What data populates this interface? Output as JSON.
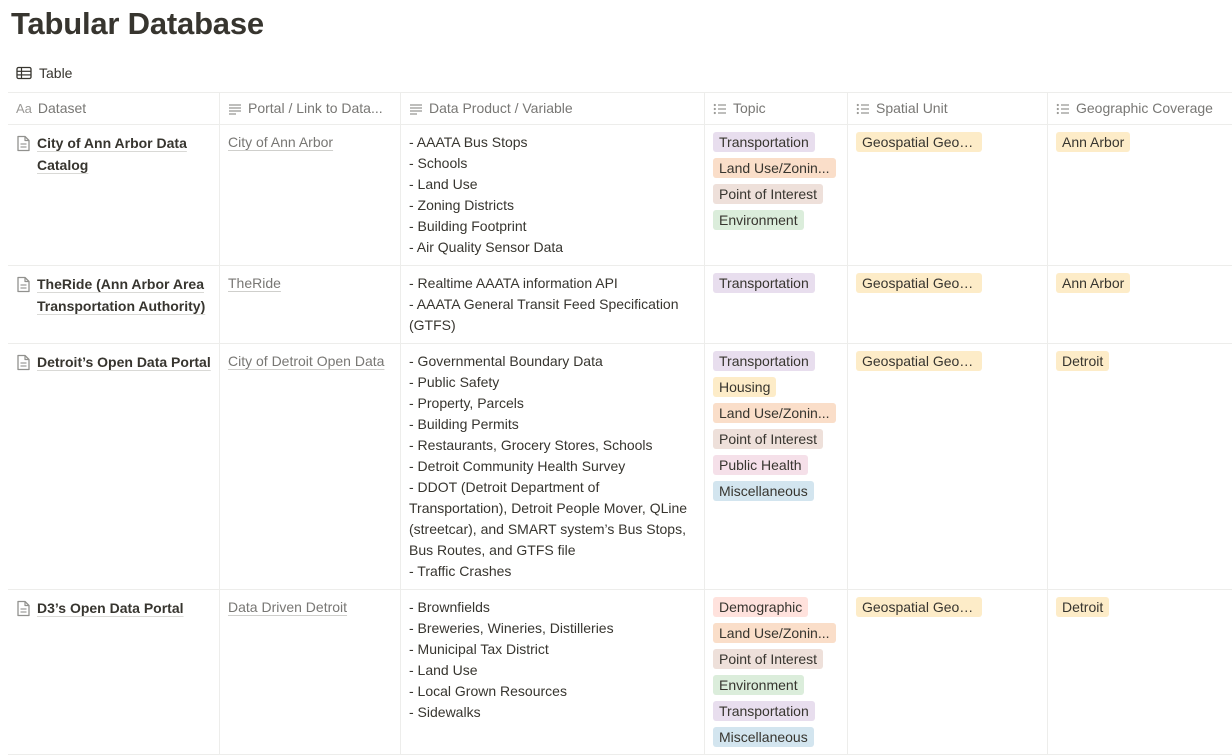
{
  "page": {
    "title": "Tabular Database"
  },
  "view": {
    "tab_label": "Table",
    "icon": "table-icon"
  },
  "columns": [
    {
      "label": "Dataset",
      "icon": "aa-icon"
    },
    {
      "label": "Portal / Link to Data...",
      "icon": "text-lines-icon"
    },
    {
      "label": "Data Product / Variable",
      "icon": "text-lines-icon"
    },
    {
      "label": "Topic",
      "icon": "multi-select-icon"
    },
    {
      "label": "Spatial Unit",
      "icon": "multi-select-icon"
    },
    {
      "label": "Geographic Coverage",
      "icon": "multi-select-icon"
    }
  ],
  "tag_colors": {
    "Transportation": "#e8deee",
    "Land Use/Zonin...": "#fadec9",
    "Point of Interest": "#eee0da",
    "Environment": "#dbeddb",
    "Housing": "#fdecc8",
    "Public Health": "#f5e0e9",
    "Miscellaneous": "#d3e5ef",
    "Demographic": "#ffe2dd",
    "Geospatial Geometry": "#fdecc8",
    "Ann Arbor": "#fdecc8",
    "Detroit": "#fdecc8"
  },
  "rows": [
    {
      "dataset": "City of Ann Arbor Data Catalog",
      "portal": "City of Ann Arbor",
      "products": [
        "- AAATA Bus Stops",
        "- Schools",
        "- Land Use",
        "- Zoning Districts",
        "- Building Footprint",
        "- Air Quality Sensor Data"
      ],
      "topics": [
        "Transportation",
        "Land Use/Zonin...",
        "Point of Interest",
        "Environment"
      ],
      "spatial_unit": [
        "Geospatial Geometry"
      ],
      "coverage": [
        "Ann Arbor"
      ]
    },
    {
      "dataset": "TheRide (Ann Arbor Area Transportation Authority)",
      "portal": "TheRide",
      "products": [
        "- Realtime AAATA information API",
        "- AAATA General Transit Feed Specification (GTFS)"
      ],
      "topics": [
        "Transportation"
      ],
      "spatial_unit": [
        "Geospatial Geometry"
      ],
      "coverage": [
        "Ann Arbor"
      ]
    },
    {
      "dataset": "Detroit’s Open Data Portal",
      "portal": "City of Detroit Open Data",
      "products": [
        "- Governmental Boundary Data",
        "- Public Safety",
        "- Property, Parcels",
        "- Building Permits",
        "- Restaurants, Grocery Stores, Schools",
        "- Detroit Community Health Survey",
        "- DDOT (Detroit Department of Transportation), Detroit People Mover, QLine (streetcar), and SMART system’s Bus Stops, Bus Routes, and GTFS file",
        "- Traffic Crashes"
      ],
      "topics": [
        "Transportation",
        "Housing",
        "Land Use/Zonin...",
        "Point of Interest",
        "Public Health",
        "Miscellaneous"
      ],
      "spatial_unit": [
        "Geospatial Geometry"
      ],
      "coverage": [
        "Detroit"
      ]
    },
    {
      "dataset": "D3’s Open Data Portal",
      "portal": "Data Driven Detroit",
      "products": [
        "- Brownfields",
        "- Breweries, Wineries, Distilleries",
        "- Municipal Tax District",
        "- Land Use",
        "- Local Grown Resources",
        "- Sidewalks"
      ],
      "topics": [
        "Demographic",
        "Land Use/Zonin...",
        "Point of Interest",
        "Environment",
        "Transportation",
        "Miscellaneous"
      ],
      "spatial_unit": [
        "Geospatial Geometry"
      ],
      "coverage": [
        "Detroit"
      ]
    }
  ]
}
